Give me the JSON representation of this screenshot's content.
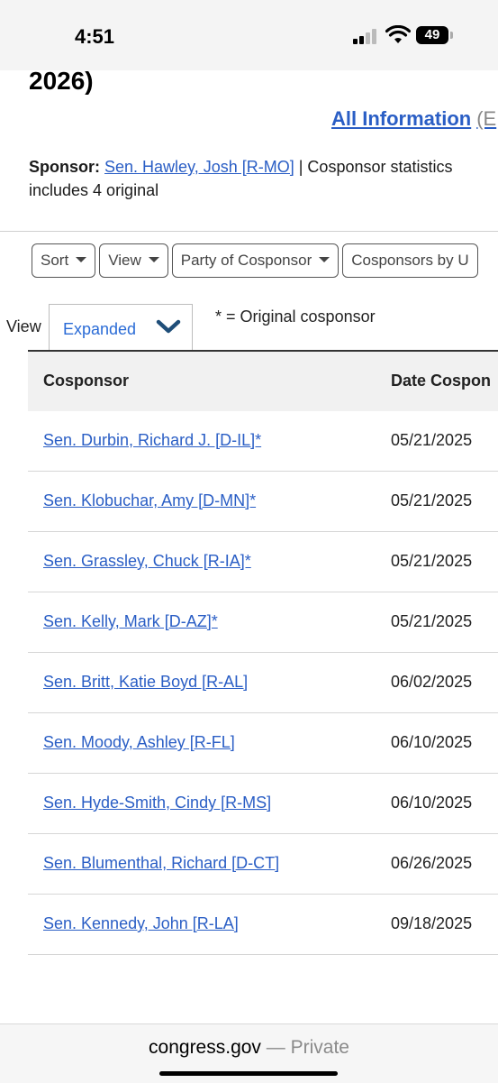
{
  "status_bar": {
    "time": "4:51",
    "battery": "49"
  },
  "page": {
    "title_tail": "2026)",
    "all_info_link": "All Information",
    "all_info_tail": "(E",
    "sponsor_label": "Sponsor:",
    "sponsor_name": "Sen. Hawley, Josh [R-MO]",
    "sponsor_rest": " | Cosponsor statistics",
    "sponsor_line2": "includes 4 original"
  },
  "filters": [
    {
      "label": "Sort"
    },
    {
      "label": "View"
    },
    {
      "label": "Party of Cosponsor"
    },
    {
      "label": "Cosponsors by U"
    }
  ],
  "view_control": {
    "label": "View",
    "selected": "Expanded",
    "note": "* = Original cosponsor"
  },
  "table": {
    "headers": [
      "Cosponsor",
      "Date Cospon"
    ],
    "rows": [
      {
        "name": "Sen. Durbin, Richard J. [D-IL]*",
        "date": "05/21/2025"
      },
      {
        "name": "Sen. Klobuchar, Amy [D-MN]*",
        "date": "05/21/2025"
      },
      {
        "name": "Sen. Grassley, Chuck [R-IA]*",
        "date": "05/21/2025"
      },
      {
        "name": "Sen. Kelly, Mark [D-AZ]*",
        "date": "05/21/2025"
      },
      {
        "name": "Sen. Britt, Katie Boyd [R-AL]",
        "date": "06/02/2025"
      },
      {
        "name": "Sen. Moody, Ashley [R-FL]",
        "date": "06/10/2025"
      },
      {
        "name": "Sen. Hyde-Smith, Cindy [R-MS]",
        "date": "06/10/2025"
      },
      {
        "name": "Sen. Blumenthal, Richard [D-CT]",
        "date": "06/26/2025"
      },
      {
        "name": "Sen. Kennedy, John [R-LA]",
        "date": "09/18/2025"
      }
    ]
  },
  "browser": {
    "domain": "congress.gov",
    "mode": " — Private"
  },
  "colors": {
    "link": "#2a5ec5",
    "select_text": "#2a6bd6",
    "chevron": "#1f4e79"
  },
  "icons": [
    "signal-icon",
    "wifi-icon",
    "battery-icon",
    "chevron-down-icon",
    "caret-down-icon"
  ]
}
